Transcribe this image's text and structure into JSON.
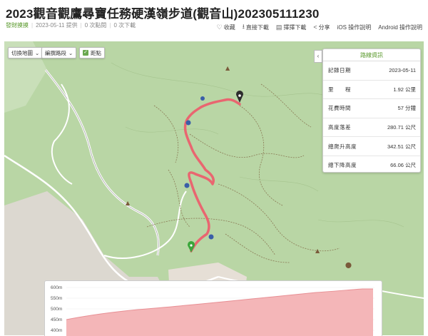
{
  "header": {
    "title": "2023觀音觀鷹尋寶任務硬漢嶺步道(觀音山)202305111230",
    "author": "發財摸摸",
    "date_text": "2023-05-11 提供",
    "likes_text": "0 次點閱",
    "downloads_text": "0 次下載"
  },
  "actions": [
    {
      "icon": "heart-icon",
      "glyph": "♡",
      "label": "收藏"
    },
    {
      "icon": "download-icon",
      "glyph": "⭳",
      "label": "直接下載"
    },
    {
      "icon": "save-icon",
      "glyph": "▤",
      "label": "擇擇下載"
    },
    {
      "icon": "share-icon",
      "glyph": "<",
      "label": "分享"
    },
    {
      "icon": "",
      "glyph": "",
      "label": "iOS 操作說明"
    },
    {
      "icon": "",
      "glyph": "",
      "label": "Android 操作說明"
    }
  ],
  "map_controls": {
    "switch_map": "切換地圖",
    "edit_route": "編撰路段",
    "distance": "距點",
    "expand": "‹"
  },
  "route_info": {
    "heading": "路線資訊",
    "rows": [
      {
        "label": "記錄日期",
        "value": "2023-05-11"
      },
      {
        "label": "里　　程",
        "value": "1.92 公里"
      },
      {
        "label": "花費時間",
        "value": "57 分鐘"
      },
      {
        "label": "高度落差",
        "value": "280.71 公尺"
      },
      {
        "label": "總爬升高度",
        "value": "342.51 公尺"
      },
      {
        "label": "總下降高度",
        "value": "66.06 公尺"
      }
    ]
  },
  "elevation": {
    "y_ticks": [
      "600m",
      "550m",
      "500m",
      "450m",
      "400m"
    ],
    "fill": "#f4b6b8",
    "line": "#e88f94"
  },
  "colors": {
    "route": "#ee5a6a",
    "map_bg": "#b9d6a5",
    "accent": "#5b9a2e"
  }
}
